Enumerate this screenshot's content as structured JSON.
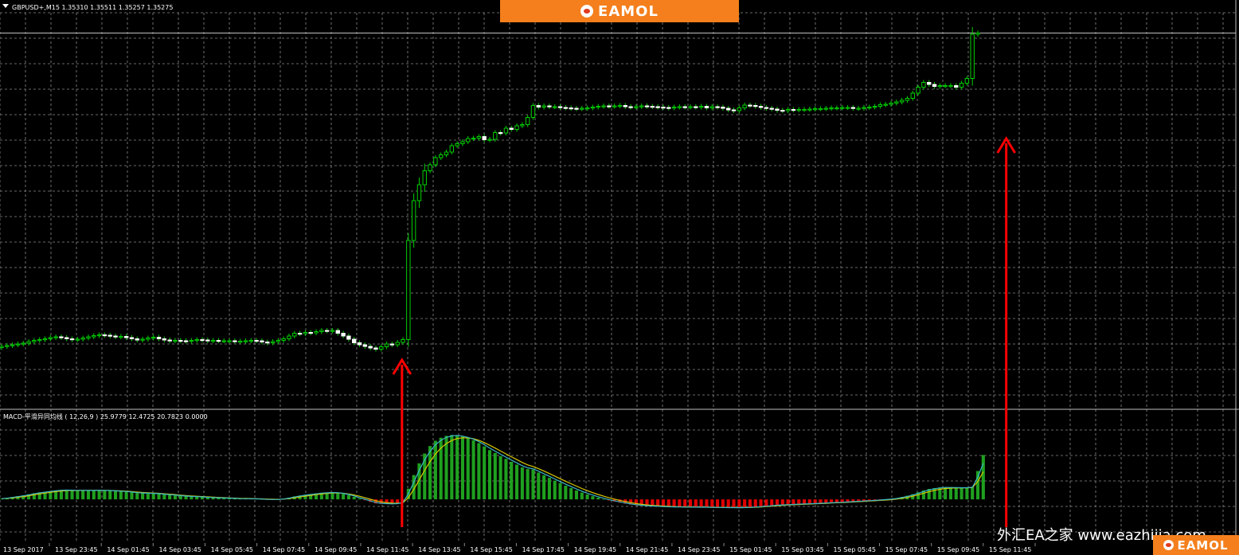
{
  "header": {
    "symbol_info": "GBPUSD+,M15 1.35310 1.35511 1.35257 1.35275",
    "brand": "EAMOL"
  },
  "macd_info": "MACD-平滑异同均线 ( 12,26,9 ) 25.9779 12.4725 20.7823 0.0000",
  "watermark": "外汇EA之家 www.eazhijia.com",
  "corner_brand": "EAMOL",
  "colors": {
    "background": "#000000",
    "grid": "#8a8a8a",
    "bull": "#00d000",
    "bear": "#ffffff",
    "macd_pos": "#1fa01f",
    "macd_neg": "#e00000",
    "signal_line": "#d6c600",
    "main_line": "#3ab6c8",
    "arrow": "#ff0000",
    "price_line": "#c0c0c0"
  },
  "icons": [
    "chart-menu-icon",
    "eamol-logo-icon"
  ],
  "chart_data": [
    {
      "type": "candlestick",
      "title": "GBPUSD+,M15 1.35310 1.35511 1.35257 1.35275",
      "xlabel": "",
      "ylabel": "",
      "x_ticks": [
        "13 Sep 2017",
        "13 Sep 23:45",
        "14 Sep 01:45",
        "14 Sep 03:45",
        "14 Sep 05:45",
        "14 Sep 07:45",
        "14 Sep 09:45",
        "14 Sep 11:45",
        "14 Sep 13:45",
        "14 Sep 15:45",
        "14 Sep 17:45",
        "14 Sep 19:45",
        "14 Sep 21:45",
        "14 Sep 23:45",
        "15 Sep 01:45",
        "15 Sep 03:45",
        "15 Sep 05:45",
        "15 Sep 07:45",
        "15 Sep 09:45",
        "15 Sep 11:45"
      ],
      "ylim": [
        0,
        100
      ],
      "grid": true,
      "closes": [
        15.4,
        15.6,
        15.8,
        16,
        16.2,
        16.6,
        16.9,
        17.1,
        17.3,
        17.6,
        17.8,
        17.6,
        17.3,
        17.1,
        17.2,
        17.5,
        17.8,
        18.1,
        18.3,
        18.2,
        18,
        17.8,
        17.9,
        17.6,
        17.3,
        17,
        17.2,
        17.5,
        17.7,
        17.3,
        17,
        16.8,
        16.9,
        16.8,
        16.7,
        16.9,
        17.1,
        17,
        16.8,
        16.9,
        16.8,
        16.8,
        16.8,
        16.7,
        16.7,
        16.8,
        16.9,
        16.8,
        16.5,
        16.3,
        16.6,
        16.9,
        17.3,
        18,
        18.7,
        18.6,
        18.9,
        18.8,
        19.1,
        19.4,
        19.3,
        19.4,
        18.7,
        18,
        17.2,
        16.3,
        15.8,
        15.4,
        15,
        14.7,
        15.3,
        16,
        15.8,
        16.4,
        17.1,
        42,
        52,
        56,
        59.5,
        61,
        62.8,
        63.5,
        64.2,
        65.8,
        66.3,
        66.8,
        67.6,
        67.7,
        68.1,
        67.3,
        67.4,
        69.1,
        69,
        70.2,
        69.9,
        70.8,
        71.1,
        72.9,
        75.9,
        75.5,
        75.8,
        75.6,
        75.6,
        75.4,
        75.3,
        75.2,
        75.1,
        75.2,
        75.3,
        75.5,
        75.7,
        75.8,
        75.7,
        75.8,
        75.9,
        75.6,
        75.5,
        75.6,
        75.8,
        75.7,
        75.6,
        75.5,
        75.4,
        75.3,
        75.5,
        75.6,
        75.5,
        75.6,
        75.5,
        75.7,
        75.3,
        75.6,
        75.5,
        75.2,
        74.8,
        74.6,
        75.3,
        76,
        75.9,
        75.7,
        75.4,
        75.2,
        75,
        74.7,
        74.6,
        74.9,
        74.8,
        74.9,
        74.9,
        75,
        75.1,
        75.1,
        75.2,
        75.3,
        75.3,
        75.4,
        75.4,
        75.2,
        75.2,
        75.4,
        75.5,
        75.7,
        76.1,
        76.2,
        76.5,
        76.8,
        77.2,
        77.7,
        79,
        80.5,
        81.7,
        81.2,
        80.7,
        80.9,
        80.9,
        80.9,
        80.5,
        81.5,
        82.7,
        93.8,
        94.1
      ]
    },
    {
      "type": "bar",
      "title": "MACD-平滑异同均线 ( 12,26,9 ) 25.9779 12.4725 20.7823 0.0000",
      "series_names": [],
      "ylim": [
        -16,
        40
      ],
      "histogram": [
        0.3,
        0.7,
        1.1,
        1.5,
        1.9,
        2.4,
        2.9,
        3.3,
        3.6,
        3.9,
        4.2,
        4.4,
        4.4,
        4.3,
        4.2,
        4.2,
        4.2,
        4.2,
        4.3,
        4.2,
        4.1,
        3.9,
        3.8,
        3.6,
        3.3,
        3,
        2.9,
        2.8,
        2.8,
        2.6,
        2.3,
        2.1,
        1.9,
        1.6,
        1.4,
        1.3,
        1.2,
        1.1,
        0.9,
        0.8,
        0.7,
        0.6,
        0.5,
        0.4,
        0.3,
        0.3,
        0.3,
        0.2,
        0.1,
        -0.1,
        -0.1,
        0,
        0.3,
        0.8,
        1.4,
        1.8,
        2.2,
        2.5,
        2.8,
        3.1,
        3.2,
        3.3,
        3.1,
        2.6,
        2,
        1.2,
        0.4,
        -0.4,
        -1.2,
        -1.9,
        -2.1,
        -2.1,
        -2.2,
        -1.9,
        -1.2,
        5,
        11.4,
        16.9,
        21.5,
        25,
        27.5,
        28.9,
        29.8,
        30.2,
        30.1,
        29.5,
        28.7,
        27.7,
        26.4,
        24.8,
        23.1,
        21.8,
        20.3,
        19,
        17.6,
        16.3,
        15,
        14.2,
        14,
        12.6,
        11.3,
        10.1,
        8.8,
        7.6,
        6.4,
        5.3,
        4.2,
        3.2,
        2.3,
        1.5,
        0.8,
        0.1,
        -0.5,
        -1,
        -1.5,
        -2,
        -2.4,
        -2.7,
        -2.9,
        -3.1,
        -3.2,
        -3.3,
        -3.4,
        -3.5,
        -3.6,
        -3.6,
        -3.6,
        -3.6,
        -3.7,
        -3.7,
        -3.7,
        -3.8,
        -3.8,
        -3.8,
        -3.9,
        -3.9,
        -3.9,
        -3.8,
        -3.7,
        -3.5,
        -3.3,
        -3.1,
        -2.8,
        -2.6,
        -2.5,
        -2.4,
        -2.3,
        -2.2,
        -2.1,
        -2,
        -1.9,
        -1.8,
        -1.6,
        -1.5,
        -1.4,
        -1.3,
        -1.1,
        -1,
        -0.8,
        -0.7,
        -0.5,
        -0.4,
        -0.2,
        0,
        0.2,
        0.6,
        1.1,
        1.7,
        2.4,
        3.3,
        4.2,
        4.9,
        5.3,
        5.6,
        5.7,
        5.6,
        5.5,
        5.4,
        5.5,
        5.8,
        13.3,
        20.8
      ]
    }
  ]
}
